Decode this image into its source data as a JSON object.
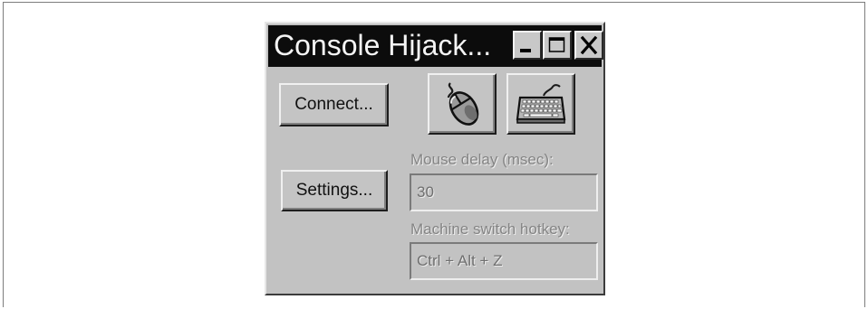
{
  "window": {
    "title": "Console Hijack...",
    "buttons": {
      "connect_label": "Connect...",
      "settings_label": "Settings...",
      "mouse_icon": "mouse-icon",
      "keyboard_icon": "keyboard-icon"
    },
    "caption_icons": [
      "minimize-icon",
      "maximize-icon",
      "close-icon"
    ],
    "mouse_delay": {
      "label": "Mouse delay (msec):",
      "value": "30"
    },
    "hotkey": {
      "label": "Machine switch hotkey:",
      "value": "Ctrl + Alt + Z"
    }
  }
}
